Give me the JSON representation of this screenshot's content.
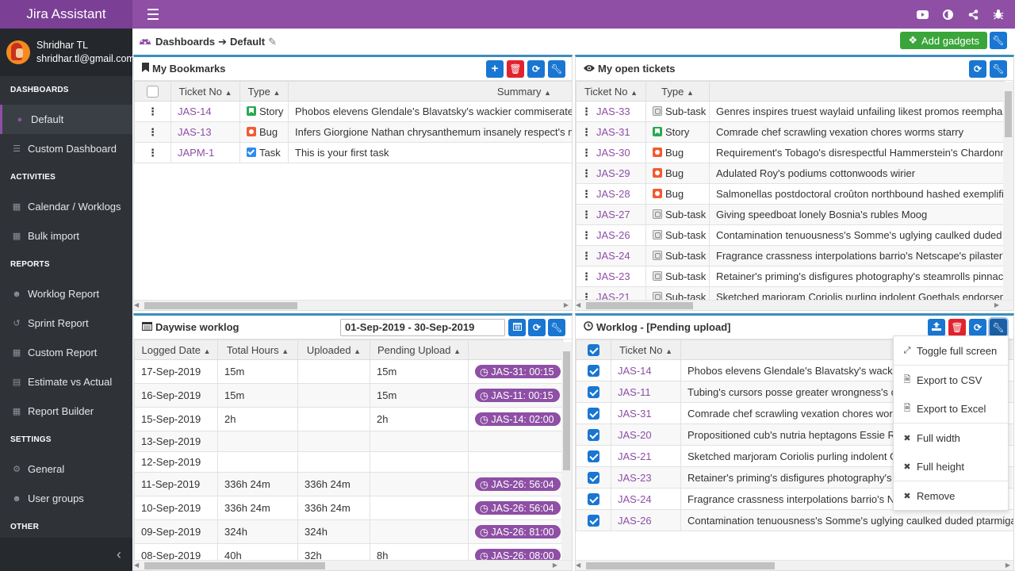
{
  "app": {
    "title": "Jira Assistant",
    "top_icons": [
      "youtube-icon",
      "contrast-icon",
      "share-icon",
      "bug-icon"
    ]
  },
  "user": {
    "name": "Shridhar TL",
    "email": "shridhar.tl@gmail.com"
  },
  "sidebar": {
    "sections": [
      {
        "title": "DASHBOARDS",
        "items": [
          {
            "label": "Default",
            "icon": "dashboard-icon",
            "active": true
          },
          {
            "label": "Custom Dashboard",
            "icon": "list-icon"
          }
        ]
      },
      {
        "title": "ACTIVITIES",
        "items": [
          {
            "label": "Calendar / Worklogs",
            "icon": "calendar-icon"
          },
          {
            "label": "Bulk import",
            "icon": "table-icon"
          }
        ]
      },
      {
        "title": "REPORTS",
        "items": [
          {
            "label": "Worklog Report",
            "icon": "users-icon"
          },
          {
            "label": "Sprint Report",
            "icon": "history-icon"
          },
          {
            "label": "Custom Report",
            "icon": "table-icon"
          },
          {
            "label": "Estimate vs Actual",
            "icon": "bar-chart-icon"
          },
          {
            "label": "Report Builder",
            "icon": "table-icon"
          }
        ]
      },
      {
        "title": "SETTINGS",
        "items": [
          {
            "label": "General",
            "icon": "gear-icon"
          },
          {
            "label": "User groups",
            "icon": "users-icon"
          }
        ]
      },
      {
        "title": "OTHER",
        "items": []
      }
    ]
  },
  "breadcrumb": {
    "root": "Dashboards",
    "current": "Default"
  },
  "actions": {
    "add_gadgets": "Add gadgets"
  },
  "bookmarks": {
    "title": "My Bookmarks",
    "columns": [
      "Ticket No",
      "Type",
      "Summary"
    ],
    "rows": [
      {
        "ticket": "JAS-14",
        "type": "Story",
        "type_icon": "story",
        "summary": "Phobos elevens Glendale's Blavatsky's wackier commiserated st"
      },
      {
        "ticket": "JAS-13",
        "type": "Bug",
        "type_icon": "bug",
        "summary": "Infers Giorgione Nathan chrysanthemum insanely respect's mise"
      },
      {
        "ticket": "JAPM-1",
        "type": "Task",
        "type_icon": "task",
        "summary": "This is your first task"
      }
    ]
  },
  "open_tickets": {
    "title": "My open tickets",
    "columns": [
      "Ticket No",
      "Type",
      ""
    ],
    "rows": [
      {
        "ticket": "JAS-33",
        "type": "Sub-task",
        "type_icon": "subtask",
        "summary": "Genres inspires truest waylaid unfailing likest promos reemphasizi"
      },
      {
        "ticket": "JAS-31",
        "type": "Story",
        "type_icon": "story",
        "summary": "Comrade chef scrawling vexation chores worms starry"
      },
      {
        "ticket": "JAS-30",
        "type": "Bug",
        "type_icon": "bug",
        "summary": "Requirement's Tobago's disrespectful Hammerstein's Chardonnay"
      },
      {
        "ticket": "JAS-29",
        "type": "Bug",
        "type_icon": "bug",
        "summary": "Adulated Roy's podiums cottonwoods wirier"
      },
      {
        "ticket": "JAS-28",
        "type": "Bug",
        "type_icon": "bug",
        "summary": "Salmonellas postdoctoral croûton northbound hashed exemplifies"
      },
      {
        "ticket": "JAS-27",
        "type": "Sub-task",
        "type_icon": "subtask",
        "summary": "Giving speedboat lonely Bosnia's rubles Moog"
      },
      {
        "ticket": "JAS-26",
        "type": "Sub-task",
        "type_icon": "subtask",
        "summary": "Contamination tenuousness's Somme's uglying caulked duded pta"
      },
      {
        "ticket": "JAS-24",
        "type": "Sub-task",
        "type_icon": "subtask",
        "summary": "Fragrance crassness interpolations barrio's Netscape's pilaster's Ku"
      },
      {
        "ticket": "JAS-23",
        "type": "Sub-task",
        "type_icon": "subtask",
        "summary": "Retainer's priming's disfigures photography's steamrolls pinnacles"
      },
      {
        "ticket": "JAS-21",
        "type": "Sub-task",
        "type_icon": "subtask",
        "summary": "Sketched marjoram Coriolis purling indolent Goethals endorsemer"
      }
    ]
  },
  "daywise": {
    "title": "Daywise worklog",
    "date_range": "01-Sep-2019 - 30-Sep-2019",
    "columns": [
      "Logged Date",
      "Total Hours",
      "Uploaded",
      "Pending Upload",
      ""
    ],
    "rows": [
      {
        "date": "17-Sep-2019",
        "total": "15m",
        "uploaded": "",
        "pending": "15m",
        "logs": [
          "JAS-31: 00:15"
        ]
      },
      {
        "date": "16-Sep-2019",
        "total": "15m",
        "uploaded": "",
        "pending": "15m",
        "logs": [
          "JAS-11: 00:15"
        ]
      },
      {
        "date": "15-Sep-2019",
        "total": "2h",
        "uploaded": "",
        "pending": "2h",
        "logs": [
          "JAS-14: 02:00"
        ]
      },
      {
        "date": "13-Sep-2019",
        "total": "",
        "uploaded": "",
        "pending": "",
        "logs": []
      },
      {
        "date": "12-Sep-2019",
        "total": "",
        "uploaded": "",
        "pending": "",
        "logs": []
      },
      {
        "date": "11-Sep-2019",
        "total": "336h 24m",
        "uploaded": "336h 24m",
        "pending": "",
        "logs": [
          "JAS-26: 56:04",
          ""
        ]
      },
      {
        "date": "10-Sep-2019",
        "total": "336h 24m",
        "uploaded": "336h 24m",
        "pending": "",
        "logs": [
          "JAS-26: 56:04",
          ""
        ]
      },
      {
        "date": "09-Sep-2019",
        "total": "324h",
        "uploaded": "324h",
        "pending": "",
        "logs": [
          "JAS-26: 81:00",
          ""
        ]
      },
      {
        "date": "08-Sep-2019",
        "total": "40h",
        "uploaded": "32h",
        "pending": "8h",
        "logs": [
          "JAS-26: 08:00",
          ""
        ]
      }
    ]
  },
  "pending": {
    "title": "Worklog - [Pending upload]",
    "columns": [
      "Ticket No",
      "Summary"
    ],
    "rows": [
      {
        "ticket": "JAS-14",
        "summary": "Phobos elevens Glendale's Blavatsky's wackier commiserated stae"
      },
      {
        "ticket": "JAS-11",
        "summary": "Tubing's cursors posse greater wrongness's crackling"
      },
      {
        "ticket": "JAS-31",
        "summary": "Comrade chef scrawling vexation chores worms starry"
      },
      {
        "ticket": "JAS-20",
        "summary": "Propositioned cub's nutria heptagons Essie Rostov's"
      },
      {
        "ticket": "JAS-21",
        "summary": "Sketched marjoram Coriolis purling indolent Goethals"
      },
      {
        "ticket": "JAS-23",
        "summary": "Retainer's priming's disfigures photography's steamrolls"
      },
      {
        "ticket": "JAS-24",
        "summary": "Fragrance crassness interpolations barrio's Netscape's"
      },
      {
        "ticket": "JAS-26",
        "summary": "Contamination tenuousness's Somme's uglying caulked duded ptarmigans c"
      }
    ]
  },
  "menu": {
    "items": [
      {
        "label": "Toggle full screen",
        "icon": "expand-icon"
      },
      {
        "label": "Export to CSV",
        "icon": "file-csv-icon"
      },
      {
        "label": "Export to Excel",
        "icon": "file-excel-icon"
      },
      {
        "label": "Full width",
        "icon": "times-icon"
      },
      {
        "label": "Full height",
        "icon": "times-icon"
      },
      {
        "label": "Remove",
        "icon": "times-icon"
      }
    ]
  },
  "colors": {
    "brand": "#8e4fa5",
    "primary": "#1976d2",
    "danger": "#e2232f",
    "success": "#3aa53a",
    "sidebar": "#2f3338"
  }
}
